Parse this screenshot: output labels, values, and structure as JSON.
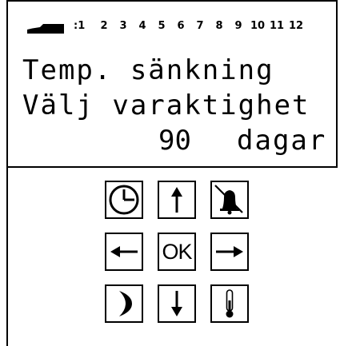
{
  "display": {
    "indicator_icon": "bed-icon",
    "day_numbers": [
      ":1",
      "2",
      "3",
      "4",
      "5",
      "6",
      "7",
      "8",
      "9",
      "10",
      "11",
      "12"
    ],
    "line1": "Temp. sänkning",
    "line2": "Välj varaktighet",
    "duration_value": "90",
    "duration_unit": "dagar"
  },
  "keypad": {
    "keys": [
      {
        "name": "clock-key",
        "icon": "clock-icon"
      },
      {
        "name": "up-key",
        "icon": "arrow-up-icon"
      },
      {
        "name": "alarm-off-key",
        "icon": "bell-crossed-icon"
      },
      {
        "name": "left-key",
        "icon": "arrow-left-icon"
      },
      {
        "name": "ok-key",
        "label": "OK"
      },
      {
        "name": "right-key",
        "icon": "arrow-right-icon"
      },
      {
        "name": "night-key",
        "icon": "moon-icon"
      },
      {
        "name": "down-key",
        "icon": "arrow-down-icon"
      },
      {
        "name": "thermometer-key",
        "icon": "thermometer-icon"
      }
    ]
  }
}
